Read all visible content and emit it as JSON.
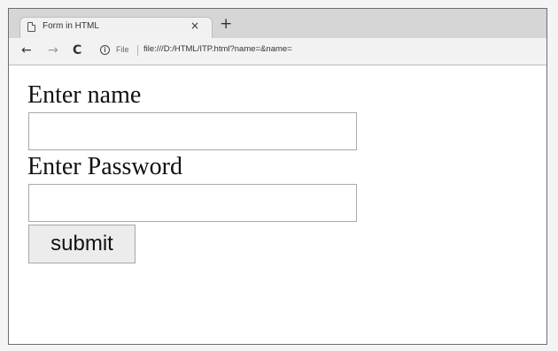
{
  "browser": {
    "tab": {
      "title": "Form in HTML",
      "close_glyph": "×",
      "icon": "page-icon"
    },
    "new_tab_glyph": "+",
    "nav": {
      "back_glyph": "←",
      "forward_glyph": "→",
      "reload_glyph": "C"
    },
    "address_bar": {
      "info_glyph": "i",
      "scheme_label": "File",
      "url": "file:///D:/HTML/ITP.html?name=&name="
    }
  },
  "form": {
    "name_label": "Enter name",
    "name_value": "",
    "password_label": "Enter Password",
    "password_value": "",
    "submit_label": "submit"
  }
}
